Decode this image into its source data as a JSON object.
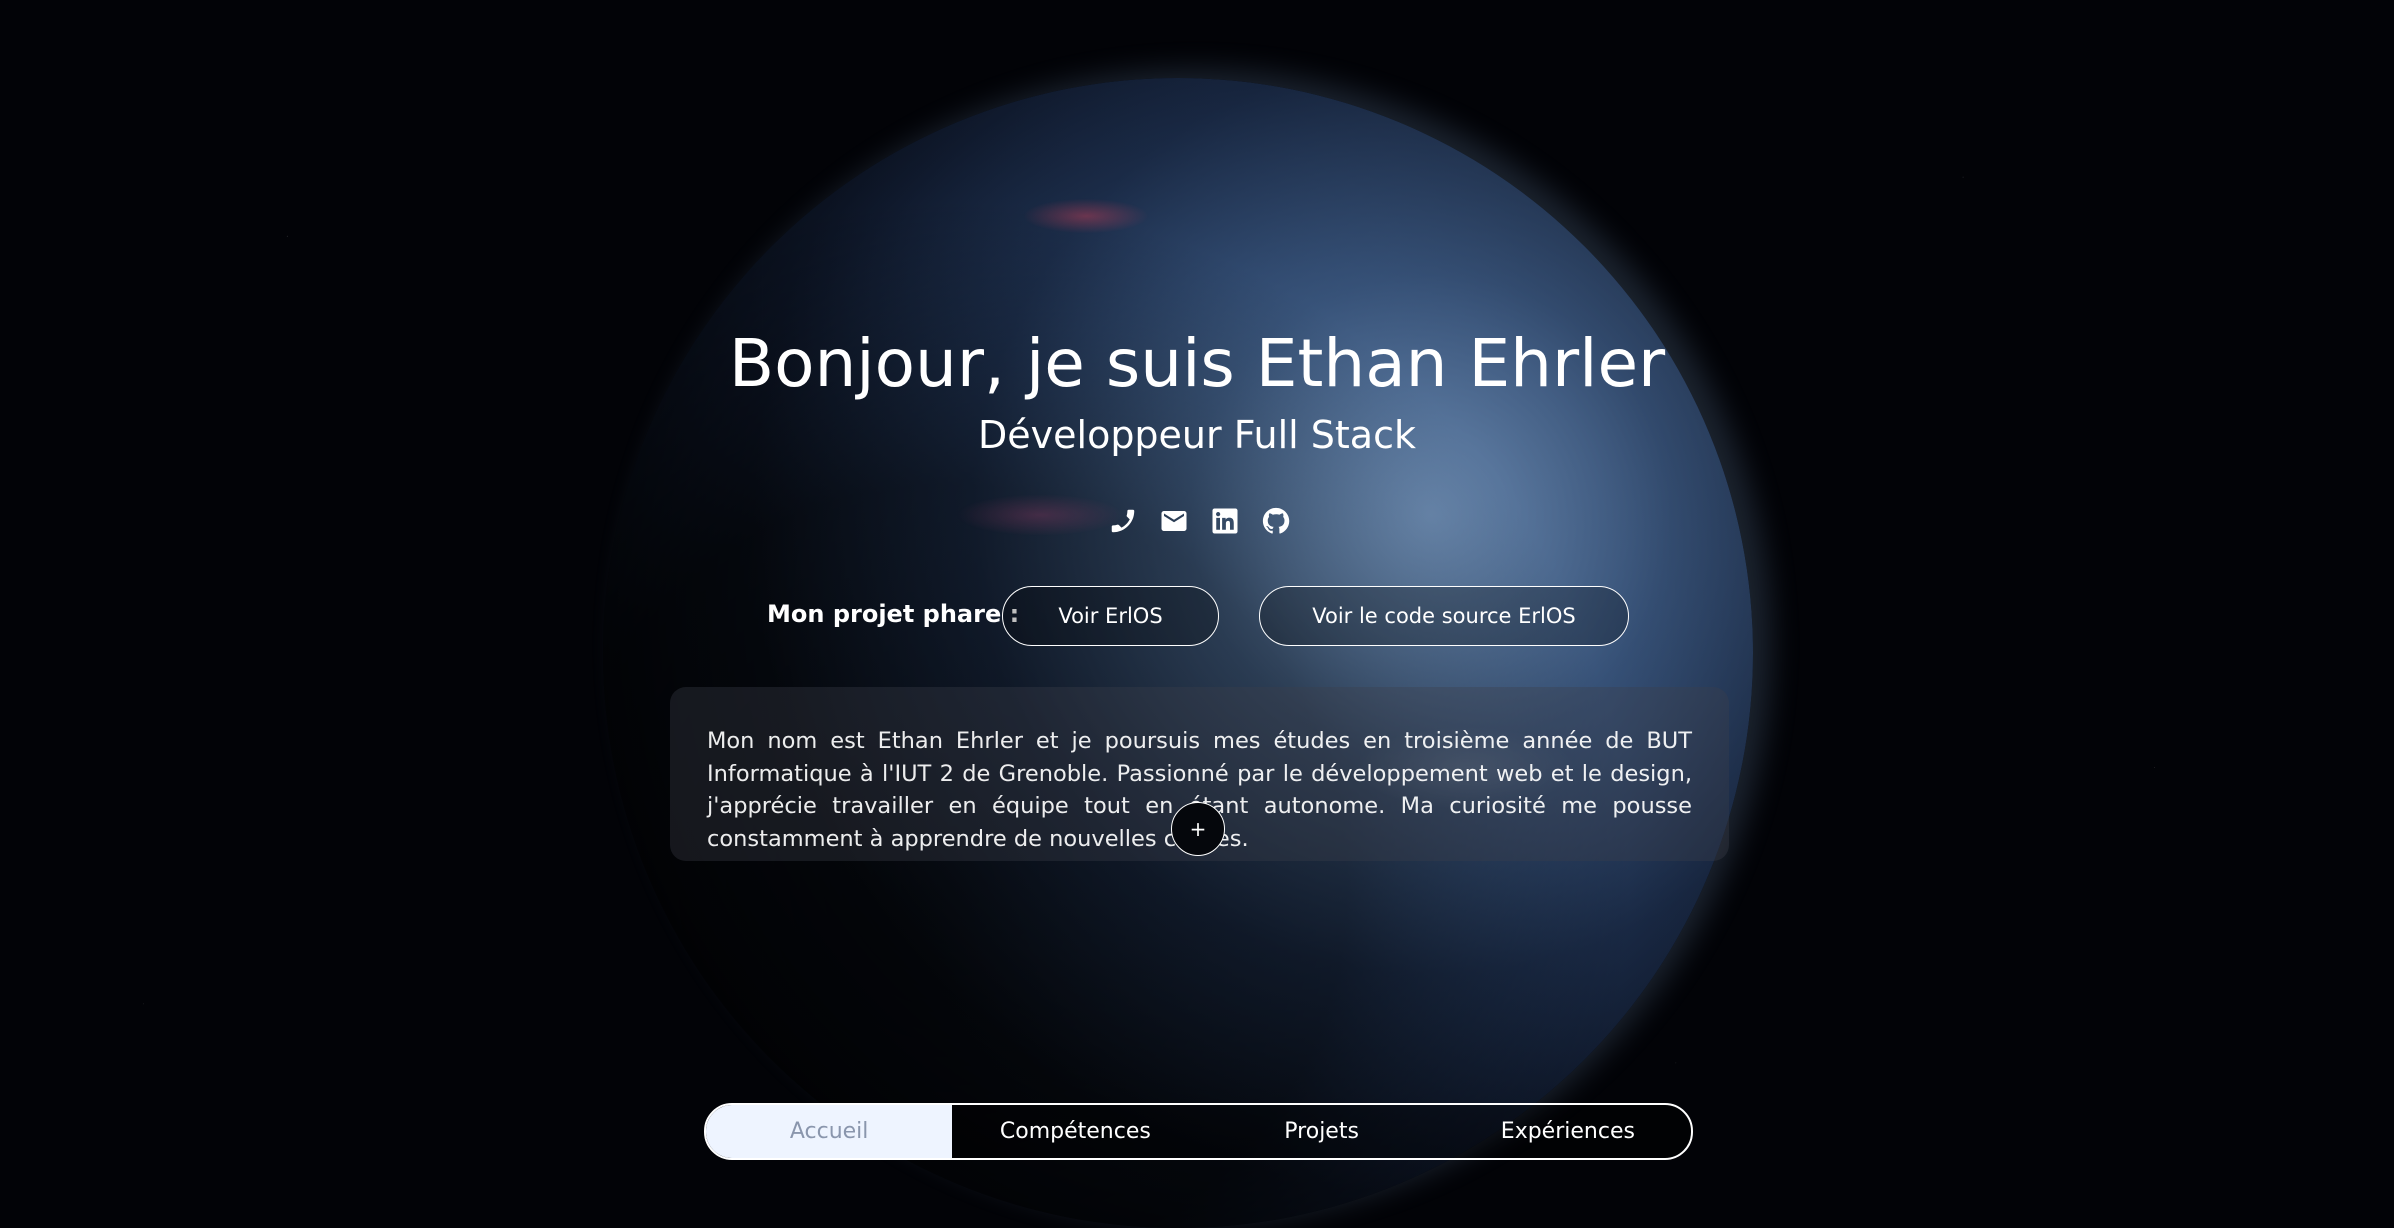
{
  "hero": {
    "title": "Bonjour, je suis Ethan Ehrler",
    "subtitle": "Développeur Full Stack"
  },
  "socials": [
    {
      "icon": "phone-icon"
    },
    {
      "icon": "mail-icon"
    },
    {
      "icon": "linkedin-icon"
    },
    {
      "icon": "github-icon"
    }
  ],
  "project": {
    "label": "Mon projet phare :",
    "view_label": "Voir ErlOS",
    "source_label": "Voir le code source ErlOS"
  },
  "about": {
    "text": "Mon nom est Ethan Ehrler et je poursuis mes études en troisième année de BUT Informatique à l'IUT 2 de Grenoble. Passionné par le développement web et le design, j'apprécie travailler en équipe tout en étant autonome. Ma curiosité me pousse constamment à apprendre de nouvelles choses.",
    "expand_label": "+"
  },
  "nav": {
    "items": [
      {
        "label": "Accueil",
        "active": true
      },
      {
        "label": "Compétences",
        "active": false
      },
      {
        "label": "Projets",
        "active": false
      },
      {
        "label": "Expériences",
        "active": false
      }
    ]
  },
  "colors": {
    "background": "#020307",
    "active_tab_bg": "#eef4ff",
    "active_tab_text": "#8a96ad"
  }
}
